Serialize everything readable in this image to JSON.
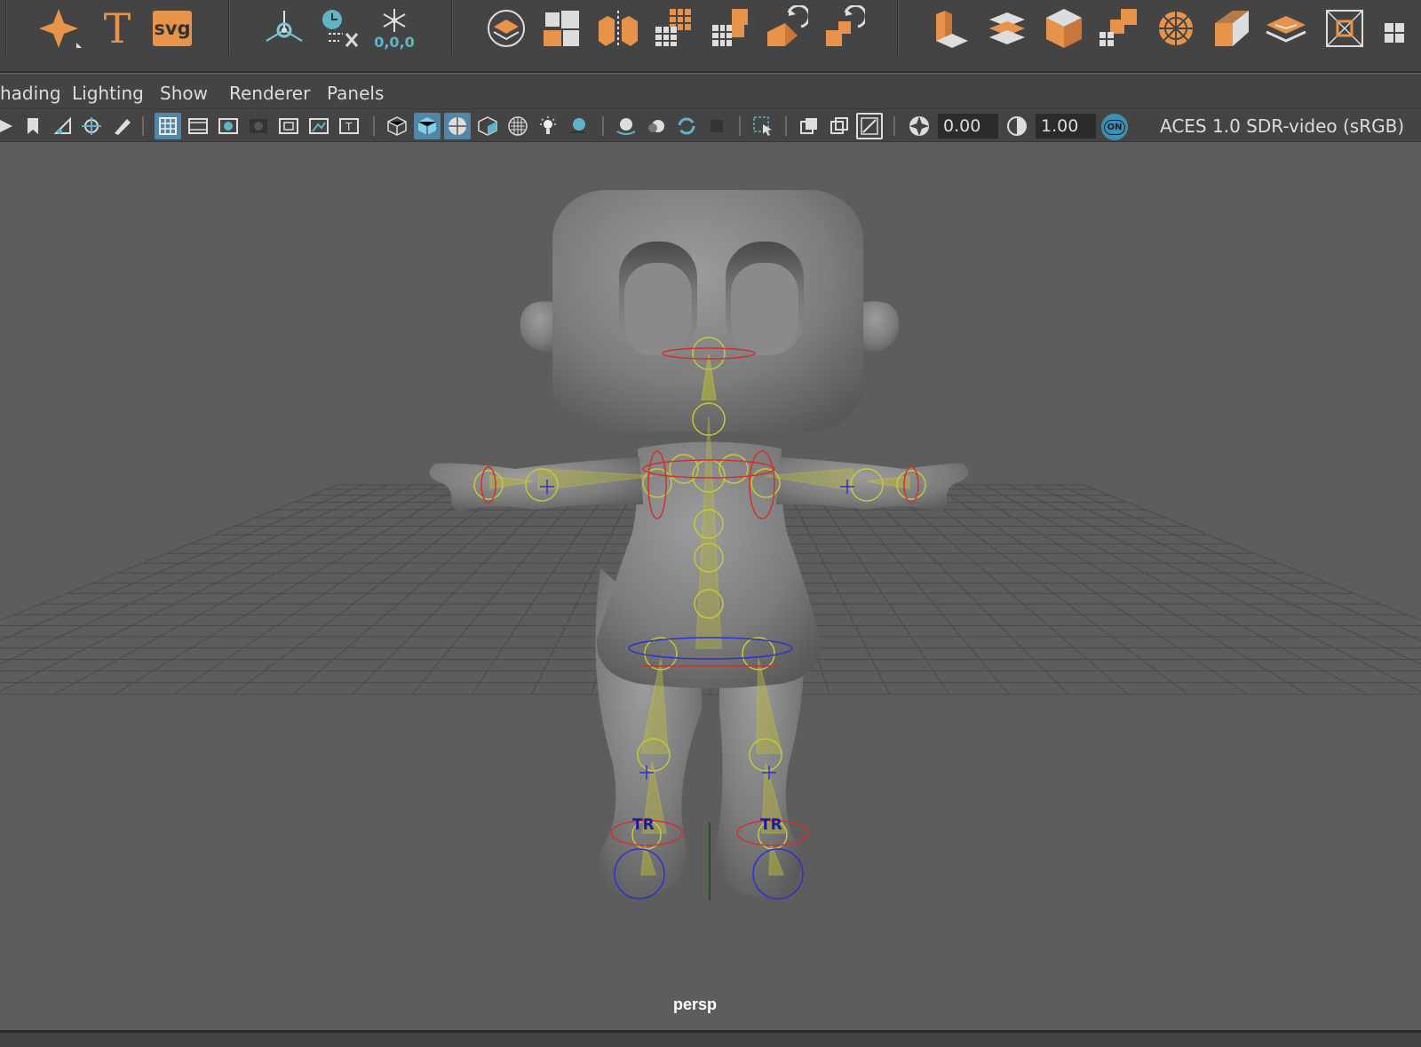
{
  "shelf": {
    "snowflake_label": "0,0,0",
    "accent": "#e8934a",
    "icons": [
      "sparkle-icon",
      "text-icon",
      "svg-icon",
      "pivot-icon",
      "clock-cross-icon",
      "freeze-transform-icon",
      "layer-icon",
      "blocks-icon",
      "split-cube-icon",
      "grid-cubes-icon",
      "stair-cubes-icon",
      "rotate-cube-icon",
      "rotate-cube-alt-icon",
      "extrude-icon",
      "layers-stack-icon",
      "cube-icon",
      "connect-cubes-icon",
      "wheel-icon",
      "cube-face-icon",
      "planes-icon",
      "bounding-box-icon"
    ],
    "svg_label": "svg",
    "text_label": "T"
  },
  "menubar": {
    "items": [
      "hading",
      "Lighting",
      "Show",
      "Renderer",
      "Panels"
    ]
  },
  "panel_toolbar": {
    "exposure_value": "0.00",
    "gamma_value": "1.00",
    "color_space": "ACES 1.0 SDR-video (sRGB)",
    "on_badge": "ON"
  },
  "viewport": {
    "camera": "persp",
    "joint_labels": [
      "TR",
      "TR"
    ]
  }
}
